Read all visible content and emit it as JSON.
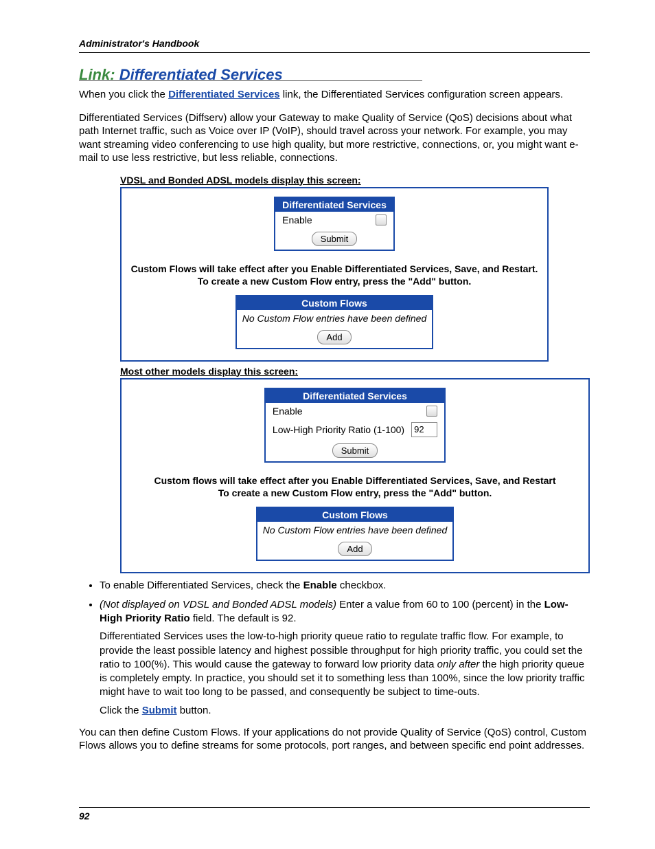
{
  "header": {
    "title": "Administrator's Handbook"
  },
  "heading": {
    "link_label": "Link:",
    "title": "Differentiated Services"
  },
  "intro": {
    "p1_a": "When you click the ",
    "p1_link": "Differentiated Services",
    "p1_b": " link, the Differentiated Services configuration screen appears.",
    "p2": "Differentiated Services (Diffserv) allow your Gateway to make Quality of Service (QoS) decisions about what path Internet traffic, such as Voice over IP (VoIP), should travel across your network. For example, you may want streaming video conferencing to use high quality, but more restrictive, connections, or, you might want e-mail to use less restrictive, but less reliable, connections."
  },
  "panel1": {
    "caption": "VDSL and Bonded ADSL models display this screen:",
    "tbl_title": "Differentiated Services",
    "enable_label": "Enable",
    "submit_label": "Submit",
    "note1": "Custom Flows will take effect after you Enable Differentiated Services, Save, and Restart.",
    "note2": "To create a new Custom Flow entry, press the \"Add\" button.",
    "flows_title": "Custom Flows",
    "flows_empty": "No Custom Flow entries have been defined",
    "add_label": "Add"
  },
  "panel2": {
    "caption": "Most other models display this screen:",
    "tbl_title": "Differentiated Services",
    "enable_label": "Enable",
    "ratio_label": "Low-High Priority Ratio (1-100)",
    "ratio_value": "92",
    "submit_label": "Submit",
    "note1": "Custom flows will take effect after you Enable Differentiated Services, Save, and Restart",
    "note2": "To create a new Custom Flow entry, press the \"Add\" button.",
    "flows_title": "Custom Flows",
    "flows_empty": "No Custom Flow entries have been defined",
    "add_label": "Add"
  },
  "bullets": {
    "b1_a": "To enable Differentiated Services, check the ",
    "b1_b": "Enable",
    "b1_c": " checkbox.",
    "b2_a": "(Not displayed on VDSL and Bonded ADSL models)",
    "b2_b": " Enter a value from 60 to 100 (percent) in the ",
    "b2_c": "Low-High Priority Ratio",
    "b2_d": " field. The default is 92.",
    "b2_p_a": "Differentiated Services uses the low-to-high priority queue ratio to regulate traffic flow. For example, to provide the least possible latency and highest possible throughput for high priority traffic, you could set the ratio to 100(%). This would cause the gateway to forward low priority data ",
    "b2_p_only": "only after",
    "b2_p_b": " the high priority queue is completely empty. In practice, you should set it to something less than 100%, since the low priority traffic might have to wait too long to be passed, and consequently be subject to time-outs.",
    "b2_click_a": "Click the ",
    "b2_click_link": "Submit",
    "b2_click_b": " button."
  },
  "outro": "You can then define Custom Flows. If your applications do not provide Quality of Service (QoS) control, Custom Flows allows you to define streams for some protocols, port ranges, and between specific end point addresses.",
  "footer": {
    "page_number": "92"
  }
}
